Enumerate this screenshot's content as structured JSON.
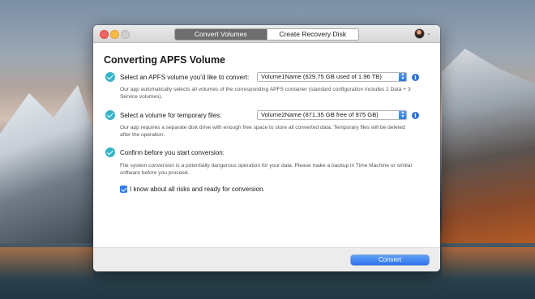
{
  "window": {
    "tabs": [
      {
        "label": "Convert Volumes",
        "active": true
      },
      {
        "label": "Create Recovery Disk",
        "active": false
      }
    ]
  },
  "main": {
    "title": "Converting APFS Volume",
    "step1": {
      "label": "Select an APFS volume you’d like to convert:",
      "selected": "Volume1Name (629.75 GB used of 1.96 TB)",
      "description": "Our app automatically selects all volumes of the corresponding APFS container (standard configuration includes 1 Data + 3 Service volumes)."
    },
    "step2": {
      "label": "Select a volume for temporary files:",
      "selected": "Volume2Name (871.35 GB free of 975 GB)",
      "description": "Our app requires a separate disk drive with enough free space to store all converted data. Temporary files will be deleted after the operation."
    },
    "step3": {
      "label": "Confirm before you start conversion:",
      "description": "File system conversion is a potentially dangerous operation for your data. Please make a backup in Time Machine or similar software before you proceed.",
      "checkbox_label": "I know about all risks and ready for conversion.",
      "checked": true
    }
  },
  "footer": {
    "convert_label": "Convert"
  },
  "colors": {
    "accent": "#2e7cf6",
    "check": "#33b6c9"
  }
}
